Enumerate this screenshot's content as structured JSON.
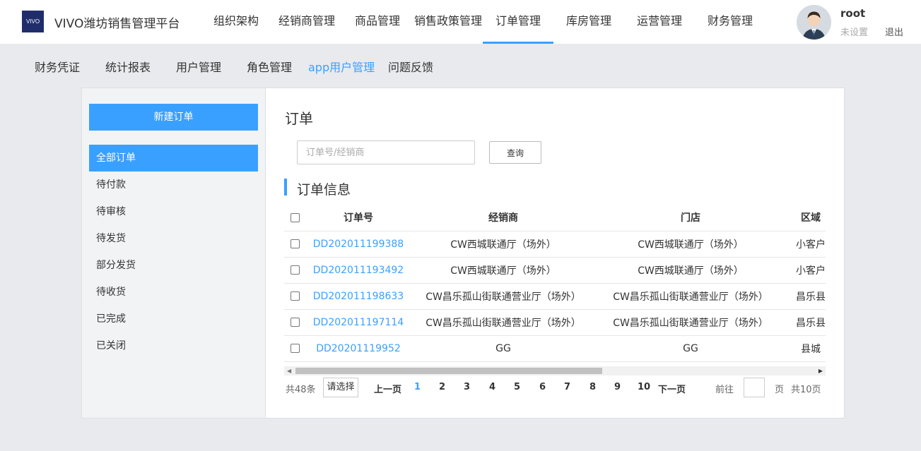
{
  "header": {
    "logo_text": "VIVO",
    "app_title": "VIVO潍坊销售管理平台",
    "nav": [
      {
        "label": "组织架构"
      },
      {
        "label": "经销商管理"
      },
      {
        "label": "商品管理"
      },
      {
        "label": "销售政策管理"
      },
      {
        "label": "订单管理",
        "active": true
      },
      {
        "label": "库房管理"
      },
      {
        "label": "运营管理"
      },
      {
        "label": "财务管理"
      }
    ],
    "user": {
      "name": "root",
      "role": "未设置",
      "logout_label": "退出"
    }
  },
  "subnav": [
    {
      "label": "财务凭证"
    },
    {
      "label": "统计报表"
    },
    {
      "label": "用户管理"
    },
    {
      "label": "角色管理"
    },
    {
      "label": "app用户管理",
      "active": true
    },
    {
      "label": "问题反馈"
    }
  ],
  "sidebar": {
    "new_order_label": "新建订单",
    "items": [
      {
        "label": "全部订单",
        "active": true
      },
      {
        "label": "待付款"
      },
      {
        "label": "待审核"
      },
      {
        "label": "待发货"
      },
      {
        "label": "部分发货"
      },
      {
        "label": "待收货"
      },
      {
        "label": "已完成"
      },
      {
        "label": "已关闭"
      }
    ]
  },
  "main": {
    "title": "订单",
    "search": {
      "placeholder": "订单号/经销商",
      "value": "",
      "button_label": "查询"
    },
    "section_title": "订单信息",
    "table": {
      "columns": [
        "订单号",
        "经销商",
        "门店",
        "区域"
      ],
      "rows": [
        {
          "order_no": "DD202011199388",
          "dealer": "CW西城联通厅（场外）",
          "store": "CW西城联通厅（场外）",
          "region": "小客户"
        },
        {
          "order_no": "DD202011193492",
          "dealer": "CW西城联通厅（场外）",
          "store": "CW西城联通厅（场外）",
          "region": "小客户"
        },
        {
          "order_no": "DD202011198633",
          "dealer": "CW昌乐孤山街联通营业厅（场外）",
          "store": "CW昌乐孤山街联通营业厅（场外）",
          "region": "昌乐县"
        },
        {
          "order_no": "DD202011197114",
          "dealer": "CW昌乐孤山街联通营业厅（场外）",
          "store": "CW昌乐孤山街联通营业厅（场外）",
          "region": "昌乐县"
        },
        {
          "order_no": "DD20201119952",
          "dealer": "GG",
          "store": "GG",
          "region": "县城"
        }
      ]
    },
    "pagination": {
      "total": "共48条",
      "page_size_placeholder": "请选择",
      "prev_label": "上一页",
      "pages": [
        "1",
        "2",
        "3",
        "4",
        "5",
        "6",
        "7",
        "8",
        "9",
        "10"
      ],
      "current": "1",
      "next_label": "下一页",
      "goto_label": "前往",
      "page_unit": "页",
      "total_pages": "共10页"
    }
  }
}
